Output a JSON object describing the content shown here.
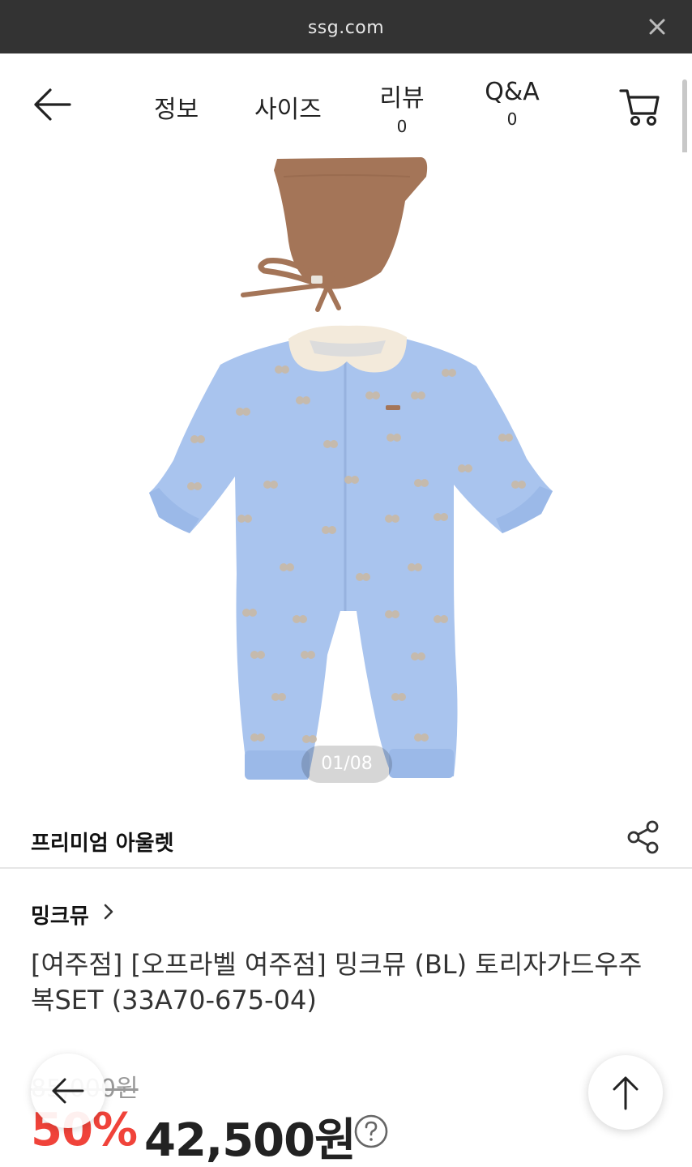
{
  "browser": {
    "url": "ssg.com",
    "close_icon": "close-icon"
  },
  "nav": {
    "back_icon": "arrow-left-icon",
    "tabs": [
      {
        "label": "정보"
      },
      {
        "label": "사이즈"
      },
      {
        "label": "리뷰",
        "count": "0"
      },
      {
        "label": "Q&A",
        "count": "0"
      }
    ],
    "cart_icon": "cart-icon"
  },
  "gallery": {
    "pager": "01/08"
  },
  "store": {
    "name": "프리미엄 아울렛",
    "share_icon": "share-icon"
  },
  "product": {
    "brand": "밍크뮤",
    "title": "[여주점] [오프라벨 여주점] 밍크뮤 (BL) 토리자가드우주복SET (33A70-675-04)",
    "original_price": "85,000원",
    "discount": "50%",
    "sale_price": "42,500원"
  },
  "colors": {
    "discount": "#f0433a",
    "urlbar_bg": "#333333",
    "romper": "#a9c4ee",
    "bonnet": "#a47558"
  }
}
